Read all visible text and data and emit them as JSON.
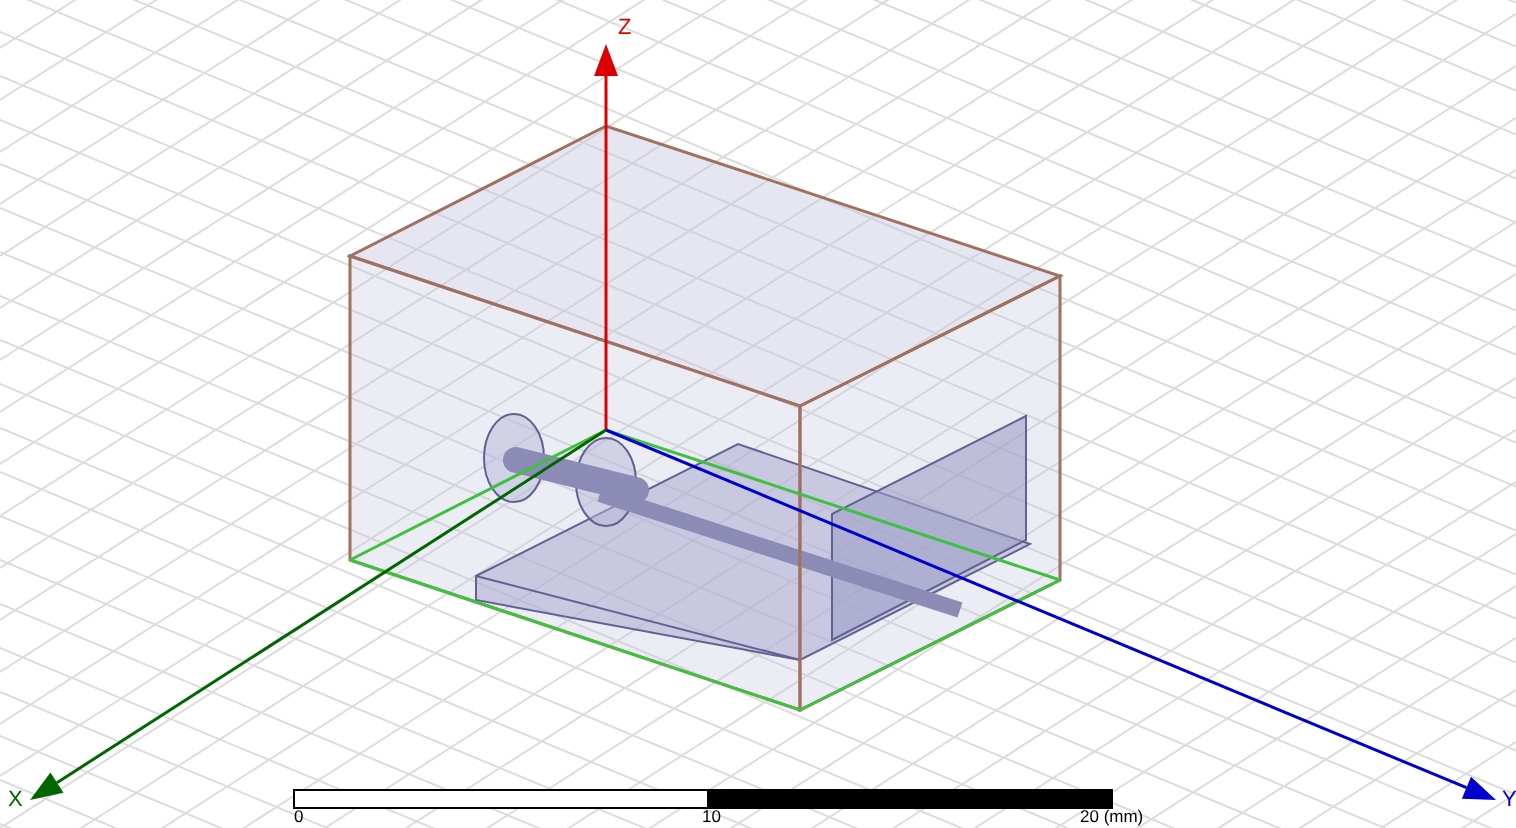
{
  "axes": [
    {
      "label": "Z",
      "color": "#dd0000",
      "kind": "z"
    },
    {
      "label": "Y",
      "color": "#0000cc",
      "kind": "y"
    },
    {
      "label": "X",
      "color": "#006600",
      "kind": "x"
    }
  ],
  "scale_bar": {
    "ticks": [
      "0",
      "10",
      "20 (mm)"
    ]
  }
}
